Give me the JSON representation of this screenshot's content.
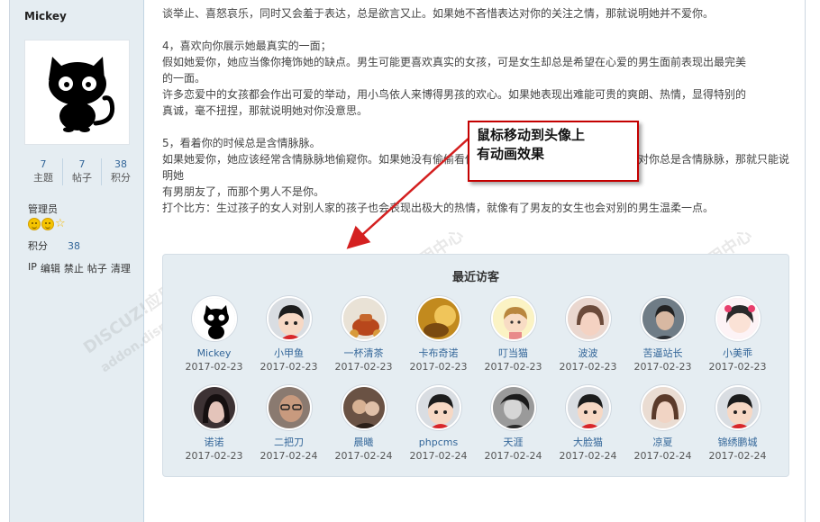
{
  "user": {
    "name": "Mickey",
    "stats": [
      {
        "num": "7",
        "label": "主题"
      },
      {
        "num": "7",
        "label": "帖子"
      },
      {
        "num": "38",
        "label": "积分"
      }
    ],
    "group": "管理员",
    "credit_label": "积分",
    "credit_value": "38",
    "actions": [
      "IP",
      "编辑",
      "禁止",
      "帖子",
      "清理"
    ]
  },
  "post": {
    "lines": [
      "谈举止、喜怒哀乐，同时又会羞于表达，总是欲言又止。如果她不吝惜表达对你的关注之情，那就说明她并不爱你。",
      "",
      "4，喜欢向你展示她最真实的一面；",
      "假如她爱你，她应当像你掩饰她的缺点。男生可能更喜欢真实的女孩，可是女生却总是希望在心爱的男生面前表现出最完美",
      "的一面。",
      "许多恋爱中的女孩都会作出可爱的举动，用小鸟依人来博得男孩的欢心。如果她表现出难能可贵的爽朗、热情，显得特别的",
      "真诚，毫不扭捏，那就说明她对你没意思。",
      "",
      "5，看着你的时候总是含情脉脉。",
      "如果她爱你，她应该经常含情脉脉地偷窥你。如果她没有偷偷看你，那么就说明她并不爱你；如果她对你总是含情脉脉，那就只能说明她",
      "有男朋友了，而那个男人不是你。",
      "打个比方：生过孩子的女人对别人家的孩子也会表现出极大的热情，就像有了男友的女生也会对别的男生温柔一点。"
    ]
  },
  "callout": {
    "line1": "鼠标移动到头像上",
    "line2": "有动画效果"
  },
  "visitors": {
    "title": "最近访客",
    "items": [
      {
        "name": "Mickey",
        "date": "2017-02-23"
      },
      {
        "name": "小甲鱼",
        "date": "2017-02-23"
      },
      {
        "name": "一杯清茶",
        "date": "2017-02-23"
      },
      {
        "name": "卡布奇诺",
        "date": "2017-02-23"
      },
      {
        "name": "叮当猫",
        "date": "2017-02-23"
      },
      {
        "name": "波波",
        "date": "2017-02-23"
      },
      {
        "name": "苦逼站长",
        "date": "2017-02-23"
      },
      {
        "name": "小美乖",
        "date": "2017-02-23"
      },
      {
        "name": "诺诺",
        "date": "2017-02-23"
      },
      {
        "name": "二把刀",
        "date": "2017-02-24"
      },
      {
        "name": "晨曦",
        "date": "2017-02-24"
      },
      {
        "name": "phpcms",
        "date": "2017-02-24"
      },
      {
        "name": "天涯",
        "date": "2017-02-24"
      },
      {
        "name": "大脸猫",
        "date": "2017-02-24"
      },
      {
        "name": "凉夏",
        "date": "2017-02-24"
      },
      {
        "name": "锦绣鹏城",
        "date": "2017-02-24"
      }
    ]
  },
  "watermark": {
    "brand": "DISCUZ!应用中心",
    "site": "addon.dismall.com"
  }
}
